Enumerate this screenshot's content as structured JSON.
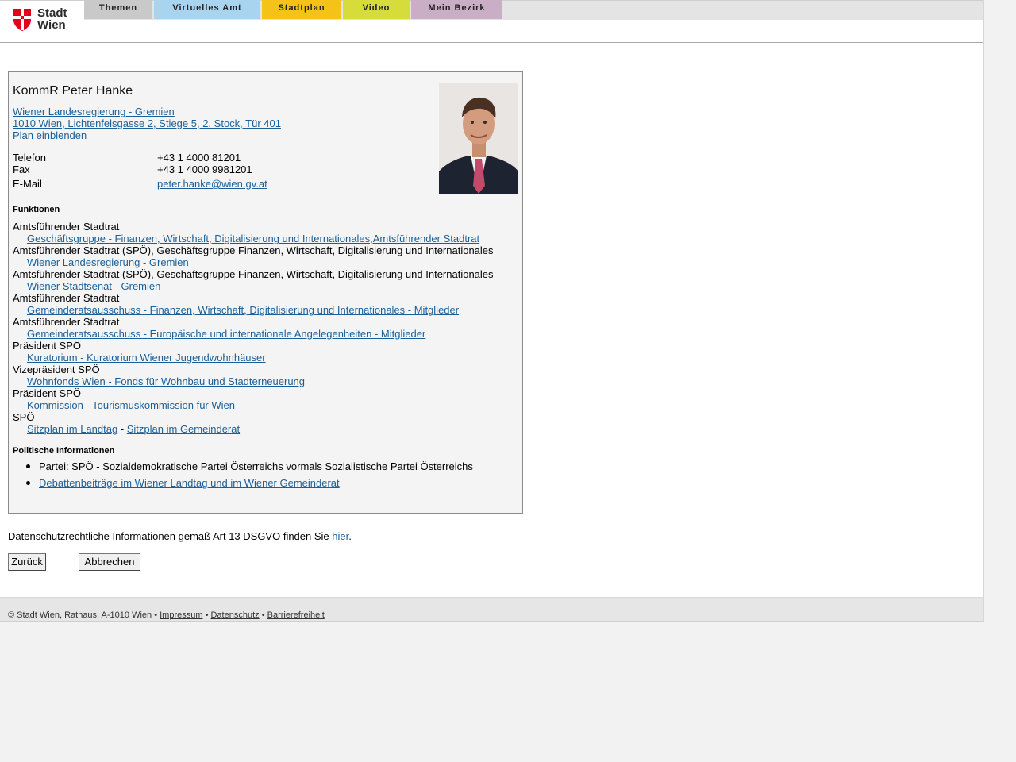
{
  "logo": {
    "line1": "Stadt",
    "line2": "Wien"
  },
  "nav": {
    "tabs": [
      {
        "label": "Themen"
      },
      {
        "label": "Virtuelles Amt"
      },
      {
        "label": "Stadtplan"
      },
      {
        "label": "Video"
      },
      {
        "label": "Mein Bezirk"
      }
    ]
  },
  "person": {
    "name": "KommR Peter Hanke",
    "org_link": "Wiener Landesregierung - Gremien ",
    "address_link": "1010 Wien, Lichtenfelsgasse 2, Stiege 5, 2. Stock, Tür 401",
    "plan_link": "Plan einblenden",
    "contact": [
      {
        "label": "Telefon",
        "value": "+43 1 4000 81201"
      },
      {
        "label": "Fax",
        "value": "+43 1 4000 9981201"
      },
      {
        "label": "E-Mail",
        "value": "peter.hanke@wien.gv.at"
      }
    ]
  },
  "functions": {
    "title": "Funktionen",
    "items": [
      {
        "role": "Amtsführender Stadtrat",
        "link": "Geschäftsgruppe - Finanzen, Wirtschaft, Digitalisierung und Internationales,Amtsführender Stadtrat"
      },
      {
        "role": "Amtsführender Stadtrat (SPÖ), Geschäftsgruppe Finanzen, Wirtschaft, Digitalisierung und Internationales",
        "link": "Wiener Landesregierung - Gremien"
      },
      {
        "role": "Amtsführender Stadtrat (SPÖ), Geschäftsgruppe Finanzen, Wirtschaft, Digitalisierung und Internationales",
        "link": "Wiener Stadtsenat - Gremien"
      },
      {
        "role": "Amtsführender Stadtrat",
        "link": "Gemeinderatsausschuss - Finanzen, Wirtschaft, Digitalisierung und Internationales - Mitglieder"
      },
      {
        "role": "Amtsführender Stadtrat",
        "link": "Gemeinderatsausschuss - Europäische und internationale Angelegenheiten - Mitglieder"
      },
      {
        "role": "Präsident SPÖ",
        "link": "Kuratorium - Kuratorium Wiener Jugendwohnhäuser"
      },
      {
        "role": "Vizepräsident SPÖ",
        "link": "Wohnfonds Wien - Fonds für Wohnbau und Stadterneuerung"
      },
      {
        "role": "Präsident SPÖ",
        "link": "Kommission - Tourismuskommission für Wien"
      }
    ],
    "last_role": "SPÖ",
    "last_link_1": "Sitzplan im Landtag",
    "last_sep": " - ",
    "last_link_2": "Sitzplan im Gemeinderat"
  },
  "political": {
    "title": "Politische Informationen",
    "party": "Partei: SPÖ - Sozialdemokratische Partei Österreichs vormals Sozialistische Partei Österreichs",
    "debate_link": "Debattenbeiträge im Wiener Landtag und im Wiener Gemeinderat"
  },
  "privacy": {
    "text": "Datenschutzrechtliche Informationen gemäß Art 13 DSGVO finden Sie ",
    "link": "hier",
    "end": "."
  },
  "buttons": {
    "back": "Zurück",
    "cancel": "Abbrechen"
  },
  "footer": {
    "copyright": "© Stadt Wien, Rathaus, A-1010 Wien • ",
    "impressum": "Impressum",
    "sep": " • ",
    "datenschutz": "Datenschutz",
    "barrierefreiheit": "Barrierefreiheit"
  },
  "colors": {
    "link": "#1a5f99",
    "tab_themen": "#c9c9c9",
    "tab_amt": "#a9d4ef",
    "tab_stadtplan": "#f5c318",
    "tab_video": "#d6dd3a",
    "tab_bezirk": "#c9aec5",
    "brand_red": "#e2001a"
  }
}
